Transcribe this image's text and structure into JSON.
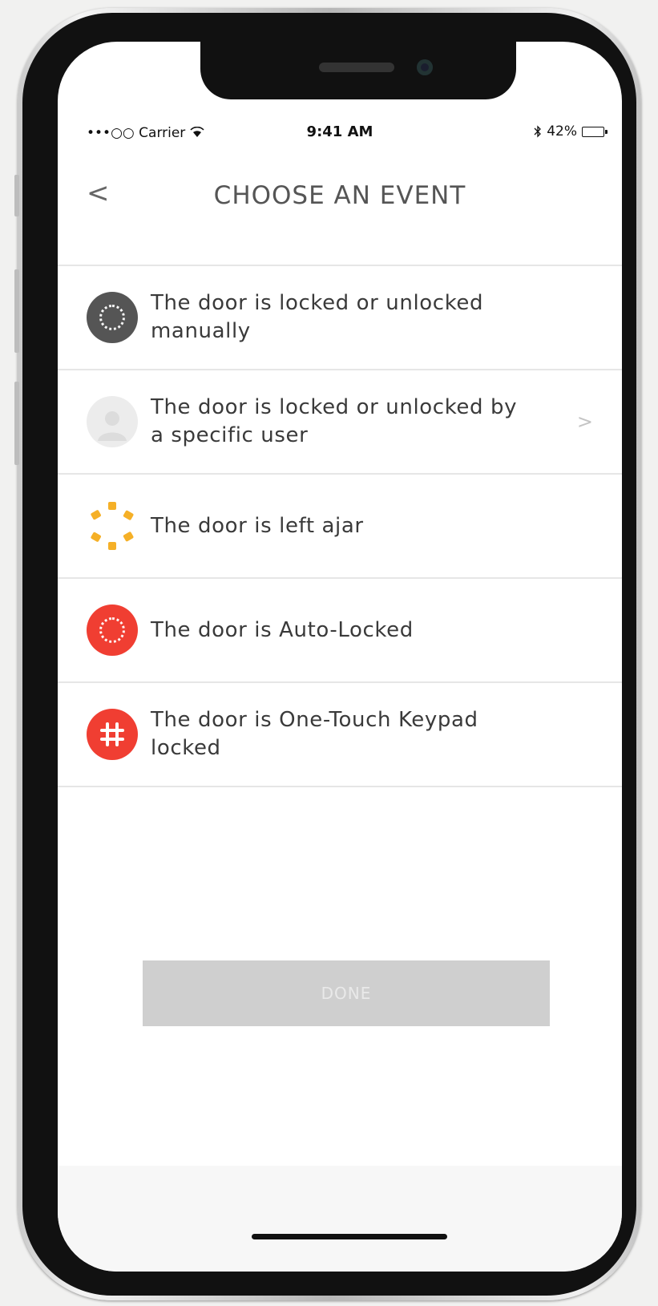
{
  "status_bar": {
    "carrier": "•••○○ Carrier",
    "wifi_icon": "wifi-icon",
    "time": "9:41 AM",
    "bluetooth_icon": "bluetooth-icon",
    "battery_text": "42%",
    "battery_level": 0.42
  },
  "nav": {
    "back_glyph": "<",
    "title": "CHOOSE AN EVENT"
  },
  "events": [
    {
      "label": "The door is locked or unlocked manually",
      "icon": "lock-circle-icon",
      "color": "#555555"
    },
    {
      "label": "The door is locked or unlocked by a specific user",
      "icon": "user-avatar-icon",
      "color": "#e6e6e6",
      "chevron": ">"
    },
    {
      "label": "The door is left ajar",
      "icon": "ajar-icon",
      "color": "#f5b027"
    },
    {
      "label": "The door is Auto-Locked",
      "icon": "auto-lock-icon",
      "color": "#f03e32"
    },
    {
      "label": "The door is One-Touch Keypad locked",
      "icon": "keypad-icon",
      "color": "#f03e32"
    }
  ],
  "done_button": {
    "label": "DONE"
  }
}
